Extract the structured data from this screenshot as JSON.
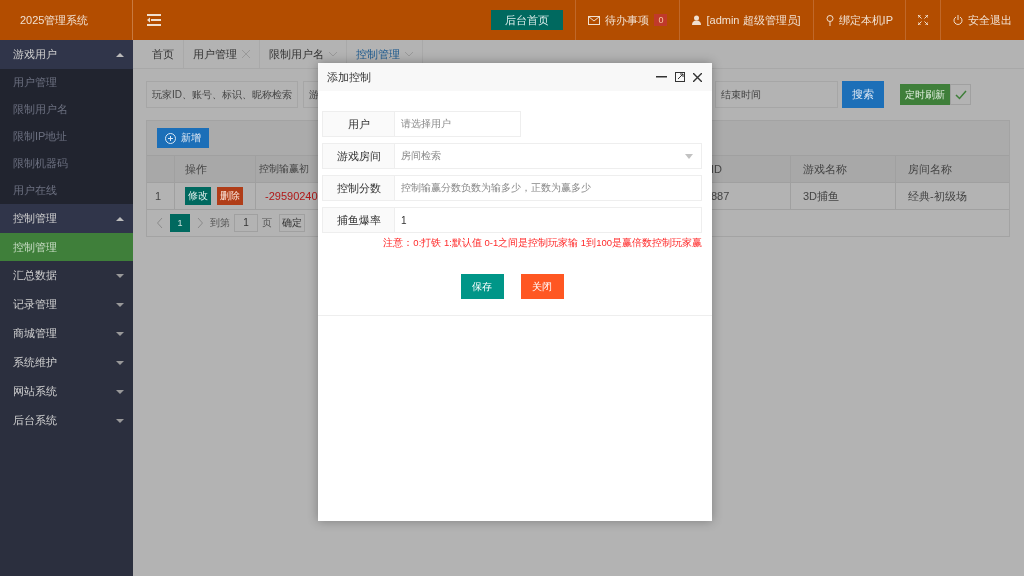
{
  "header": {
    "logo": "2025管理系统",
    "home_button": "后台首页",
    "todo": {
      "label": "待办事项",
      "count": "0"
    },
    "user": "[admin 超级管理员]",
    "bind_ip": "绑定本机IP",
    "logout": "安全退出"
  },
  "sidebar": {
    "groups": [
      {
        "label": "游戏用户",
        "expanded": true,
        "children": [
          {
            "label": "用户管理",
            "selected": false
          },
          {
            "label": "限制用户名",
            "selected": false
          },
          {
            "label": "限制IP地址",
            "selected": false
          },
          {
            "label": "限制机器码",
            "selected": false
          },
          {
            "label": "用户在线",
            "selected": false
          }
        ]
      },
      {
        "label": "控制管理",
        "expanded": true,
        "children": [
          {
            "label": "控制管理",
            "selected": true
          }
        ]
      },
      {
        "label": "汇总数据",
        "expanded": false
      },
      {
        "label": "记录管理",
        "expanded": false
      },
      {
        "label": "商城管理",
        "expanded": false
      },
      {
        "label": "系统维护",
        "expanded": false
      },
      {
        "label": "网站系统",
        "expanded": false
      },
      {
        "label": "后台系统",
        "expanded": false
      }
    ]
  },
  "tabs": [
    {
      "label": "首页",
      "selected": false,
      "kind": "plain"
    },
    {
      "label": "用户管理",
      "selected": false,
      "kind": "close"
    },
    {
      "label": "限制用户名",
      "selected": false,
      "kind": "menu"
    },
    {
      "label": "控制管理",
      "selected": true,
      "kind": "menu"
    }
  ],
  "search": {
    "player_placeholder": "玩家ID、账号、标识、昵称检索",
    "game_placeholder": "游",
    "end_placeholder": "结束时间",
    "search_button": "搜索",
    "refresh_button": "定时刷新",
    "auto_refresh": true
  },
  "table": {
    "add_button": "新增",
    "columns": [
      "",
      "操作",
      "控制输赢初",
      "ID",
      "游戏名称",
      "房间名称"
    ],
    "rows": [
      {
        "index": "1",
        "edit": "修改",
        "delete": "删除",
        "column_3": "-29590240",
        "id": "887",
        "game": "3D捕鱼",
        "room": "经典-初级场"
      }
    ],
    "pager": {
      "page": "1",
      "goto_label": "到第",
      "goto_value": "1",
      "page_label": "页",
      "confirm": "确定"
    }
  },
  "dialog": {
    "title": "添加控制",
    "fields": [
      {
        "label": "用户",
        "kind": "input",
        "placeholder": "请选择用户",
        "short": true
      },
      {
        "label": "游戏房间",
        "kind": "select",
        "placeholder": "房间检索",
        "short": false
      },
      {
        "label": "控制分数",
        "kind": "input",
        "placeholder": "控制输赢分数负数为输多少，正数为赢多少",
        "short": false
      },
      {
        "label": "捕鱼爆率",
        "kind": "input",
        "value": "1",
        "short": false
      }
    ],
    "note": "注意：0:打铁 1:默认值 0-1之间是控制玩家输 1到100是赢倍数控制玩家赢",
    "save": "保存",
    "close": "关闭"
  }
}
